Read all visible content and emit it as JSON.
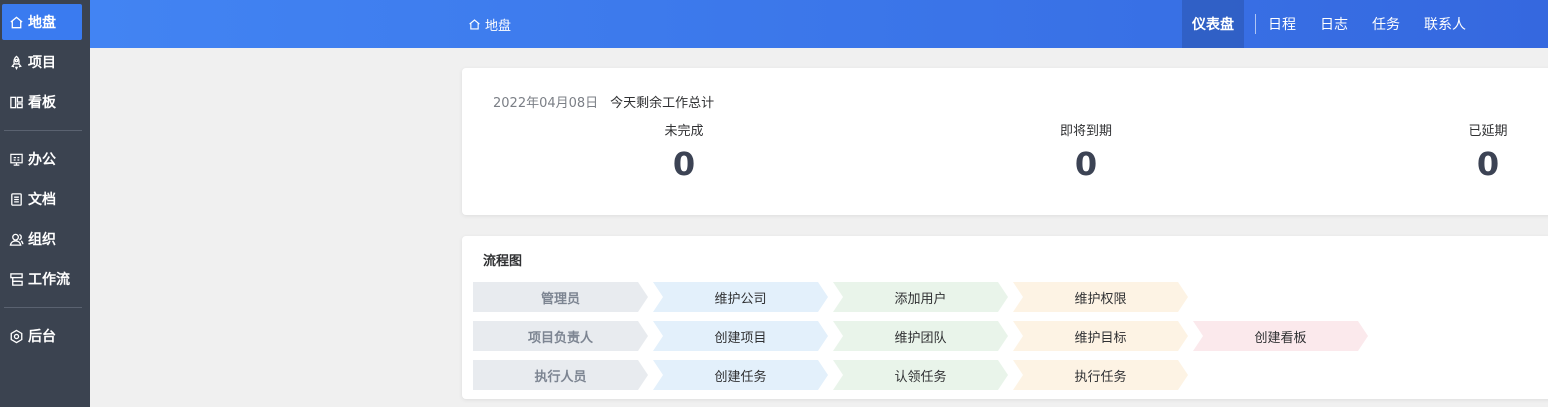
{
  "sidebar": {
    "items": [
      {
        "label": "地盘",
        "icon": "home-icon",
        "active": true
      },
      {
        "label": "项目",
        "icon": "rocket-icon"
      },
      {
        "label": "看板",
        "icon": "board-icon"
      },
      {
        "label": "办公",
        "icon": "monitor-icon"
      },
      {
        "label": "文档",
        "icon": "document-icon"
      },
      {
        "label": "组织",
        "icon": "people-icon"
      },
      {
        "label": "工作流",
        "icon": "workflow-icon"
      },
      {
        "label": "后台",
        "icon": "gear-icon"
      }
    ]
  },
  "header": {
    "breadcrumb": "地盘",
    "nav": {
      "active": "仪表盘",
      "items": [
        "日程",
        "日志",
        "任务",
        "联系人"
      ]
    }
  },
  "summary": {
    "date": "2022年04月08日",
    "label": "今天剩余工作总计",
    "stats": [
      {
        "label": "未完成",
        "value": "0"
      },
      {
        "label": "即将到期",
        "value": "0"
      },
      {
        "label": "已延期",
        "value": "0"
      }
    ]
  },
  "flow": {
    "title": "流程图",
    "rows": [
      {
        "role": "管理员",
        "steps": [
          "维护公司",
          "添加用户",
          "维护权限"
        ]
      },
      {
        "role": "项目负责人",
        "steps": [
          "创建项目",
          "维护团队",
          "维护目标",
          "创建看板"
        ]
      },
      {
        "role": "执行人员",
        "steps": [
          "创建任务",
          "认领任务",
          "执行任务"
        ]
      }
    ]
  },
  "colors": {
    "sidebar_bg": "#3b4350",
    "accent": "#3a7bf0",
    "step_blue": "#e3f0fb",
    "step_green": "#e9f4ea",
    "step_orange": "#fdf3e4",
    "step_pink": "#fbe9ec"
  }
}
